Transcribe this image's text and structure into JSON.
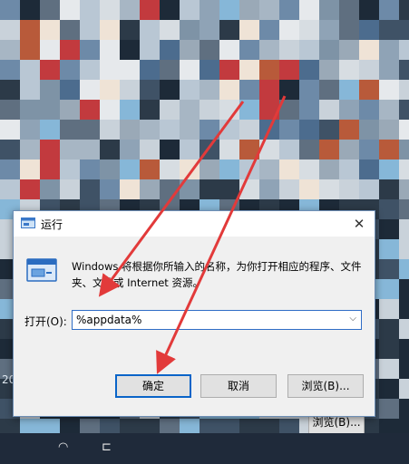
{
  "dialog": {
    "title": "运行",
    "close_glyph": "✕",
    "description": "Windows 将根据你所输入的名称，为你打开相应的程序、文件夹、文档或 Internet 资源。",
    "open_label": "打开(O):",
    "open_value": "%appdata%",
    "ok_label": "确定",
    "cancel_label": "取消",
    "browse_label": "浏览(B)..."
  },
  "background": {
    "behind_button_label": "浏览(B)...",
    "desktop_text": "20"
  },
  "taskbar": {
    "icons": [
      "spinner-icon",
      "cursor-icon"
    ]
  },
  "colors": {
    "annotation_arrow": "#e23a3a",
    "focus_border": "#0a64c8"
  }
}
